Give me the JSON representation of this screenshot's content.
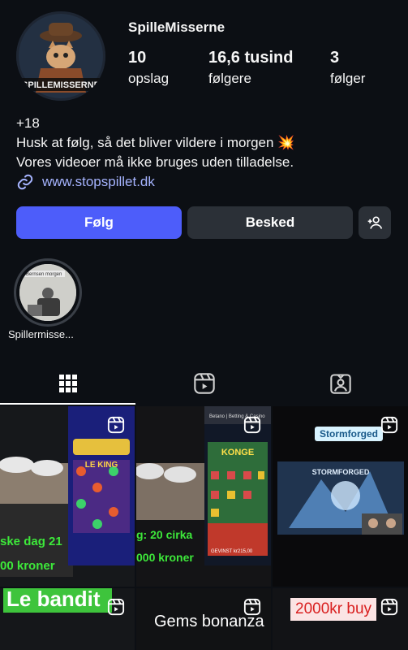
{
  "profile": {
    "username": "SpilleMisserne",
    "avatar_text": "SPILLEMISSERNE",
    "stats": [
      {
        "value": "10",
        "label": "opslag"
      },
      {
        "value": "16,6 tusind",
        "label": "følgere"
      },
      {
        "value": "3",
        "label": "følger"
      }
    ],
    "bio": [
      "+18",
      "Husk at følg, så det bliver vildere i morgen 💥",
      "Vores videoer må ikke bruges uden tilladelse."
    ],
    "link": "www.stopspillet.dk"
  },
  "actions": {
    "follow": "Følg",
    "message": "Besked",
    "add_user_icon": "add-person-icon"
  },
  "highlights": [
    {
      "label": "Spillermisse...",
      "inner_text": "Bernsen morgen"
    }
  ],
  "tabs": [
    {
      "name": "grid",
      "icon": "grid-icon"
    },
    {
      "name": "reels",
      "icon": "reels-icon"
    },
    {
      "name": "tagged",
      "icon": "tagged-icon"
    }
  ],
  "posts": [
    {
      "overlay": [
        "ske dag 21",
        "00 kroner"
      ],
      "slot_title": "LE KING"
    },
    {
      "overlay": [
        "g: 20 cirka",
        "000 kroner"
      ],
      "slot_title": "KONGE",
      "header": "Betano | Betting & Casino",
      "win": "GEVINST kr215,00"
    },
    {
      "badge": "Stormforged",
      "game_title": "STORMFORGED"
    },
    {
      "caption": "Le bandit"
    },
    {
      "caption": "Gems bonanza"
    },
    {
      "caption": "2000kr buy"
    }
  ],
  "colors": {
    "accent": "#4d5dfa",
    "link": "#a6b4ff",
    "caption_green": "#3de83a"
  }
}
